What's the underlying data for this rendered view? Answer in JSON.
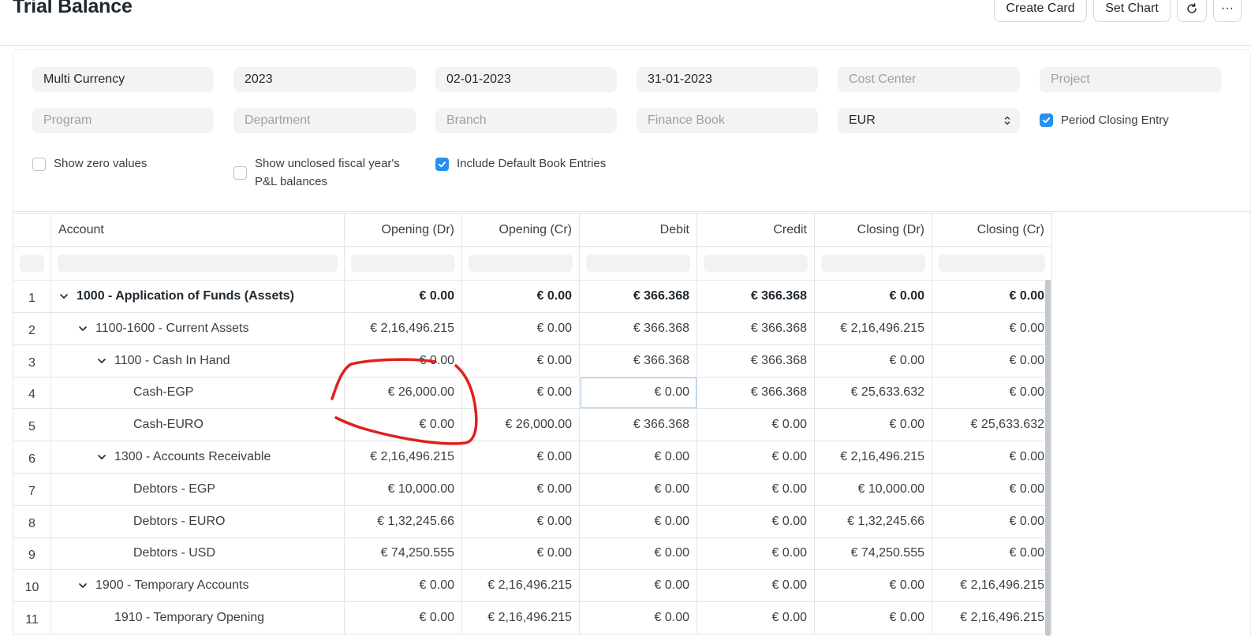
{
  "header": {
    "title": "Trial Balance",
    "create_card_label": "Create Card",
    "set_chart_label": "Set Chart",
    "more_label": "···"
  },
  "filters": {
    "presentation_currency_mode": "Multi Currency",
    "fiscal_year": "2023",
    "from_date": "02-01-2023",
    "to_date": "31-01-2023",
    "cost_center_placeholder": "Cost Center",
    "project_placeholder": "Project",
    "program_placeholder": "Program",
    "department_placeholder": "Department",
    "branch_placeholder": "Branch",
    "finance_book_placeholder": "Finance Book",
    "currency": "EUR",
    "period_closing_entry_label": "Period Closing Entry",
    "show_zero_values_label": "Show zero values",
    "show_unclosed_line1": "Show unclosed fiscal year's",
    "show_unclosed_line2": "P&L balances",
    "include_default_book_label": "Include Default Book Entries"
  },
  "checks": {
    "period_closing_entry": true,
    "show_zero_values": false,
    "show_unclosed": false,
    "include_default_book": true
  },
  "table": {
    "columns": [
      "Account",
      "Opening (Dr)",
      "Opening (Cr)",
      "Debit",
      "Credit",
      "Closing (Dr)",
      "Closing (Cr)"
    ],
    "rows": [
      {
        "idx": "1",
        "account": "1000 - Application of Funds (Assets)",
        "level": 0,
        "group": true,
        "bold": true,
        "values": [
          "€ 0.00",
          "€ 0.00",
          "€ 366.368",
          "€ 366.368",
          "€ 0.00",
          "€ 0.00"
        ]
      },
      {
        "idx": "2",
        "account": "1100-1600 - Current Assets",
        "level": 1,
        "group": true,
        "bold": false,
        "values": [
          "€ 2,16,496.215",
          "€ 0.00",
          "€ 366.368",
          "€ 366.368",
          "€ 2,16,496.215",
          "€ 0.00"
        ]
      },
      {
        "idx": "3",
        "account": "1100 - Cash In Hand",
        "level": 2,
        "group": true,
        "bold": false,
        "values": [
          "€ 0.00",
          "€ 0.00",
          "€ 366.368",
          "€ 366.368",
          "€ 0.00",
          "€ 0.00"
        ]
      },
      {
        "idx": "4",
        "account": "Cash-EGP",
        "level": 3,
        "group": false,
        "bold": false,
        "values": [
          "€ 26,000.00",
          "€ 0.00",
          "€ 0.00",
          "€ 366.368",
          "€ 25,633.632",
          "€ 0.00"
        ]
      },
      {
        "idx": "5",
        "account": "Cash-EURO",
        "level": 3,
        "group": false,
        "bold": false,
        "values": [
          "€ 0.00",
          "€ 26,000.00",
          "€ 366.368",
          "€ 0.00",
          "€ 0.00",
          "€ 25,633.632"
        ]
      },
      {
        "idx": "6",
        "account": "1300 - Accounts Receivable",
        "level": 2,
        "group": true,
        "bold": false,
        "values": [
          "€ 2,16,496.215",
          "€ 0.00",
          "€ 0.00",
          "€ 0.00",
          "€ 2,16,496.215",
          "€ 0.00"
        ]
      },
      {
        "idx": "7",
        "account": "Debtors - EGP",
        "level": 3,
        "group": false,
        "bold": false,
        "values": [
          "€ 10,000.00",
          "€ 0.00",
          "€ 0.00",
          "€ 0.00",
          "€ 10,000.00",
          "€ 0.00"
        ]
      },
      {
        "idx": "8",
        "account": "Debtors - EURO",
        "level": 3,
        "group": false,
        "bold": false,
        "values": [
          "€ 1,32,245.66",
          "€ 0.00",
          "€ 0.00",
          "€ 0.00",
          "€ 1,32,245.66",
          "€ 0.00"
        ]
      },
      {
        "idx": "9",
        "account": "Debtors - USD",
        "level": 3,
        "group": false,
        "bold": false,
        "values": [
          "€ 74,250.555",
          "€ 0.00",
          "€ 0.00",
          "€ 0.00",
          "€ 74,250.555",
          "€ 0.00"
        ]
      },
      {
        "idx": "10",
        "account": "1900 - Temporary Accounts",
        "level": 1,
        "group": true,
        "bold": false,
        "values": [
          "€ 0.00",
          "€ 2,16,496.215",
          "€ 0.00",
          "€ 0.00",
          "€ 0.00",
          "€ 2,16,496.215"
        ]
      },
      {
        "idx": "11",
        "account": "1910 - Temporary Opening",
        "level": 2,
        "group": false,
        "bold": false,
        "values": [
          "€ 0.00",
          "€ 2,16,496.215",
          "€ 0.00",
          "€ 0.00",
          "€ 0.00",
          "€ 2,16,496.215"
        ]
      }
    ]
  },
  "colors": {
    "accent": "#2490ef",
    "annotation": "#e0201c"
  },
  "icons": {
    "refresh": "refresh-icon",
    "expand": "chevron-down-icon",
    "check": "check-icon"
  }
}
